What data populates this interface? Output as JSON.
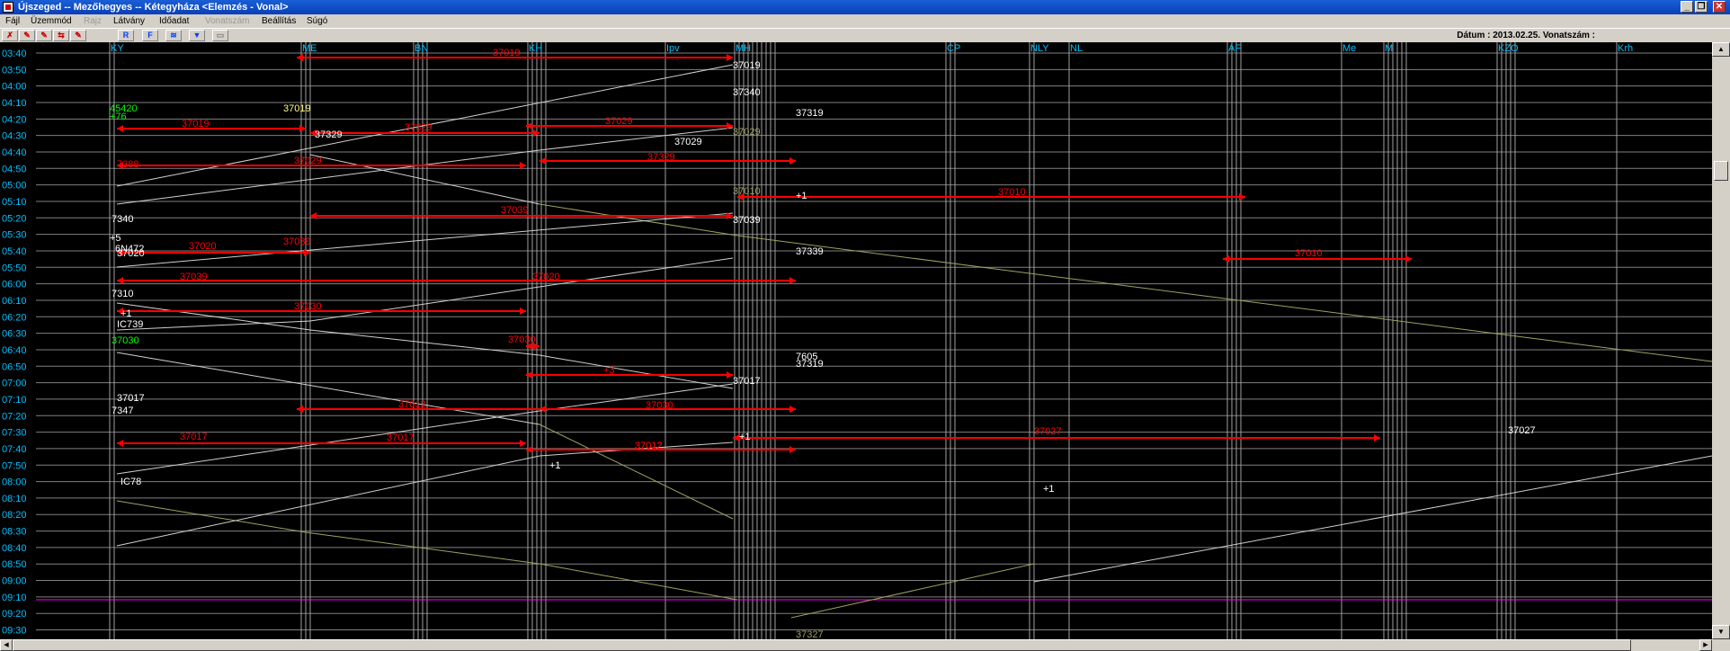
{
  "window": {
    "title": "Újszeged -- Mezőhegyes -- Kétegyháza <Elemzés - Vonal>",
    "buttons": [
      "_",
      "❐",
      "✕"
    ]
  },
  "menu": [
    {
      "label": "Fájl",
      "disabled": false
    },
    {
      "label": "Üzemmód",
      "disabled": false
    },
    {
      "label": "Rajz",
      "disabled": true
    },
    {
      "label": "Látvány",
      "disabled": false
    },
    {
      "label": "Időadat",
      "disabled": false
    },
    {
      "label": "Vonatszám",
      "disabled": true
    },
    {
      "label": "Beállítás",
      "disabled": false
    },
    {
      "label": "Súgó",
      "disabled": false
    }
  ],
  "toolbar": {
    "buttons": [
      {
        "name": "tool-1-icon",
        "glyph": "✗"
      },
      {
        "name": "tool-2-icon",
        "glyph": "✎"
      },
      {
        "name": "tool-3-icon",
        "glyph": "✎"
      },
      {
        "name": "tool-4-icon",
        "glyph": "⇆"
      },
      {
        "name": "tool-5-icon",
        "glyph": "✎"
      },
      {
        "name": "r-button",
        "glyph": "R"
      },
      {
        "name": "f-button",
        "glyph": "F"
      },
      {
        "name": "tool-8-icon",
        "glyph": "≋"
      },
      {
        "name": "filter-icon",
        "glyph": "▼"
      },
      {
        "name": "tool-10-icon",
        "glyph": "▭"
      }
    ],
    "datum_label": "Dátum : 2013.02.25. Vonatszám :"
  },
  "colors": {
    "grid": "#808080",
    "time_label": "#00c0ff",
    "station_label": "#00c0ff",
    "train_red": "#ff0000",
    "train_white": "#ffffff",
    "train_yellow": "#ffff80",
    "train_green": "#00ff00",
    "purple_line": "#ff00ff",
    "olive": "#a0a060"
  },
  "stations": [
    "KY",
    "ME",
    "BN",
    "KH",
    "Ipv",
    "MH",
    "CP",
    "NLY",
    "NL",
    "AF",
    "Me",
    "M",
    "KZO",
    "Krh"
  ],
  "times": [
    "03:40",
    "03:50",
    "04:00",
    "04:10",
    "04:20",
    "04:30",
    "04:40",
    "04:50",
    "05:00",
    "05:10",
    "05:20",
    "05:30",
    "05:40",
    "05:50",
    "06:00",
    "06:10",
    "06:20",
    "06:30",
    "06:40",
    "06:50",
    "07:00",
    "07:10",
    "07:20",
    "07:30",
    "07:40",
    "07:50",
    "08:00",
    "08:10",
    "08:20",
    "08:30",
    "08:40",
    "08:50",
    "09:00",
    "09:10",
    "09:20",
    "09:30"
  ],
  "labels": [
    "37019",
    "37019",
    "37340",
    "37319",
    "45420",
    "+76",
    "37019",
    "37029",
    "37019",
    "37329",
    "37329",
    "37029",
    "37029",
    "7388",
    "37029",
    "37329",
    "37010",
    "+1",
    "37010",
    "37039",
    "7340",
    "37039",
    "+5",
    "6N472",
    "37020",
    "37039",
    "37339",
    "37010",
    "37020",
    "37039",
    "37020",
    "37030",
    "7310",
    "37030",
    "+1",
    "IC739",
    "37030",
    "7605",
    "37319",
    "+3",
    "37017",
    "37017",
    "7347",
    "37012",
    "37017",
    "37030",
    "37017",
    "37012",
    "37027",
    "37027",
    "37012",
    "+1",
    "+1",
    "IC78",
    "+1",
    "37327"
  ]
}
